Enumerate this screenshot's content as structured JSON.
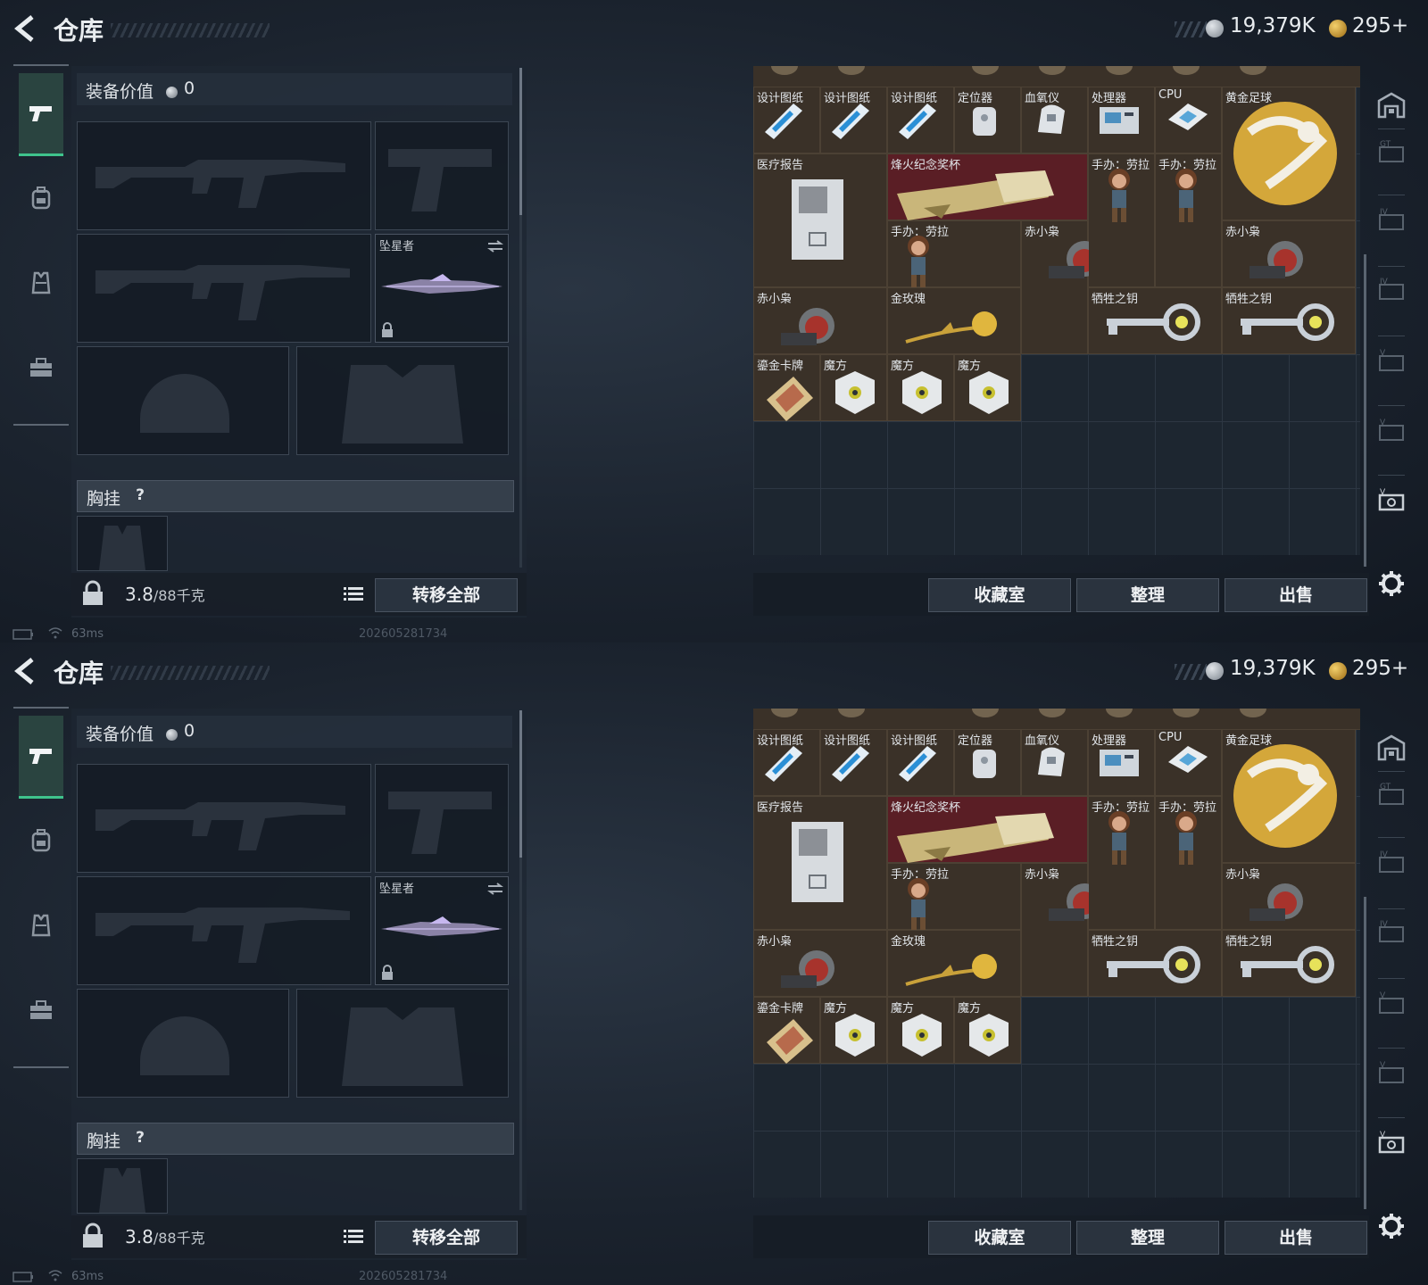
{
  "header": {
    "title": "仓库",
    "silver_amount": "19,379K",
    "gold_amount": "295+"
  },
  "sidebar": {
    "items": [
      {
        "icon": "pistol-icon",
        "active": true
      },
      {
        "icon": "backpack-icon",
        "active": false
      },
      {
        "icon": "vest-icon",
        "active": false
      },
      {
        "icon": "toolbox-icon",
        "active": false
      }
    ]
  },
  "equipment": {
    "value_label": "装备价值",
    "value": "0",
    "melee_name": "坠星者",
    "chest_label": "胸挂",
    "chest_help": "?",
    "weight_current": "3.8",
    "weight_max": "/88千克",
    "transfer_all": "转移全部"
  },
  "status": {
    "ping": "63ms",
    "build": "202605281734"
  },
  "storage": {
    "items": [
      {
        "label": "设计图纸",
        "icon": "blueprint-icon"
      },
      {
        "label": "设计图纸",
        "icon": "blueprint-icon"
      },
      {
        "label": "设计图纸",
        "icon": "blueprint-icon"
      },
      {
        "label": "定位器",
        "icon": "locator-icon"
      },
      {
        "label": "血氧仪",
        "icon": "oximeter-icon"
      },
      {
        "label": "处理器",
        "icon": "processor-icon"
      },
      {
        "label": "CPU",
        "icon": "cpu-icon"
      },
      {
        "label": "黄金足球",
        "icon": "golden-football-icon"
      },
      {
        "label": "医疗报告",
        "icon": "medical-report-icon"
      },
      {
        "label": "烽火纪念奖杯",
        "icon": "trophy-icon"
      },
      {
        "label": "手办：劳拉",
        "icon": "figurine-icon"
      },
      {
        "label": "手办：劳拉",
        "icon": "figurine-icon"
      },
      {
        "label": "手办：劳拉",
        "icon": "figurine-icon"
      },
      {
        "label": "赤小枭",
        "icon": "red-owl-icon"
      },
      {
        "label": "赤小枭",
        "icon": "red-owl-icon"
      },
      {
        "label": "赤小枭",
        "icon": "red-owl-icon"
      },
      {
        "label": "金玫瑰",
        "icon": "golden-rose-icon"
      },
      {
        "label": "牺牲之钥",
        "icon": "key-icon"
      },
      {
        "label": "牺牲之钥",
        "icon": "key-icon"
      },
      {
        "label": "鎏金卡牌",
        "icon": "gilded-card-icon"
      },
      {
        "label": "魔方",
        "icon": "cube-icon"
      },
      {
        "label": "魔方",
        "icon": "cube-icon"
      },
      {
        "label": "魔方",
        "icon": "cube-icon"
      }
    ]
  },
  "actions": {
    "collection": "收藏室",
    "sort": "整理",
    "sell": "出售"
  },
  "colors": {
    "accent_green": "#3fc38c",
    "item_bg": "#3a3128",
    "trophy_bg": "#5a1e25"
  }
}
